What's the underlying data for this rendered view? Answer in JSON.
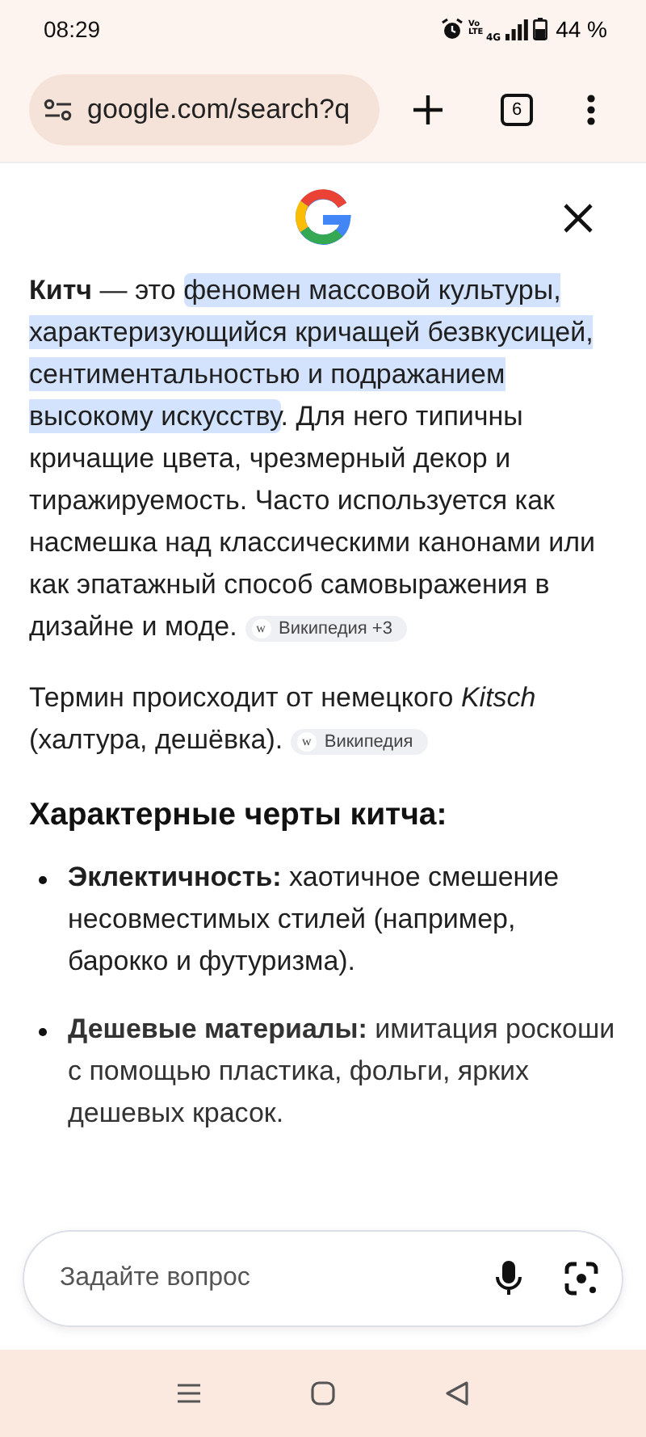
{
  "status_bar": {
    "time": "08:29",
    "volte": "Vo LTE",
    "network": "4G",
    "battery": "44 %"
  },
  "address_bar": {
    "url": "google.com/search?q",
    "tab_count": "6"
  },
  "intro": {
    "lead": "**Китч** — это ",
    "highlight": "феномен массовой культуры, характеризующийся кричащей безвкусицей, сентиментальностью и подражанием высокому искусству",
    "rest": ". Для него типичны кричащие цвета, чрезмерный декор и тиражируемость. Часто используется как насмешка над классическими канонами или как эпатажный способ самовыражения в дизайне и моде.",
    "source": {
      "favicon": "w",
      "label": "Википедия +3"
    }
  },
  "origin": {
    "text": "Термин происходит от немецкого *Kitsch* (халтура, дешёвка).",
    "source": {
      "favicon": "w",
      "label": "Википедия"
    }
  },
  "heading": "Характерные черты китча:",
  "features": [
    {
      "title": "Эклектичность:",
      "text": "хаотичное смешение несовместимых стилей (например, барокко и футуризма)."
    },
    {
      "title": "Дешевые материалы:",
      "text": "имитация роскоши с помощью пластика, фольги, ярких дешевых красок."
    }
  ],
  "ask": {
    "placeholder": "Задайте вопрос"
  }
}
